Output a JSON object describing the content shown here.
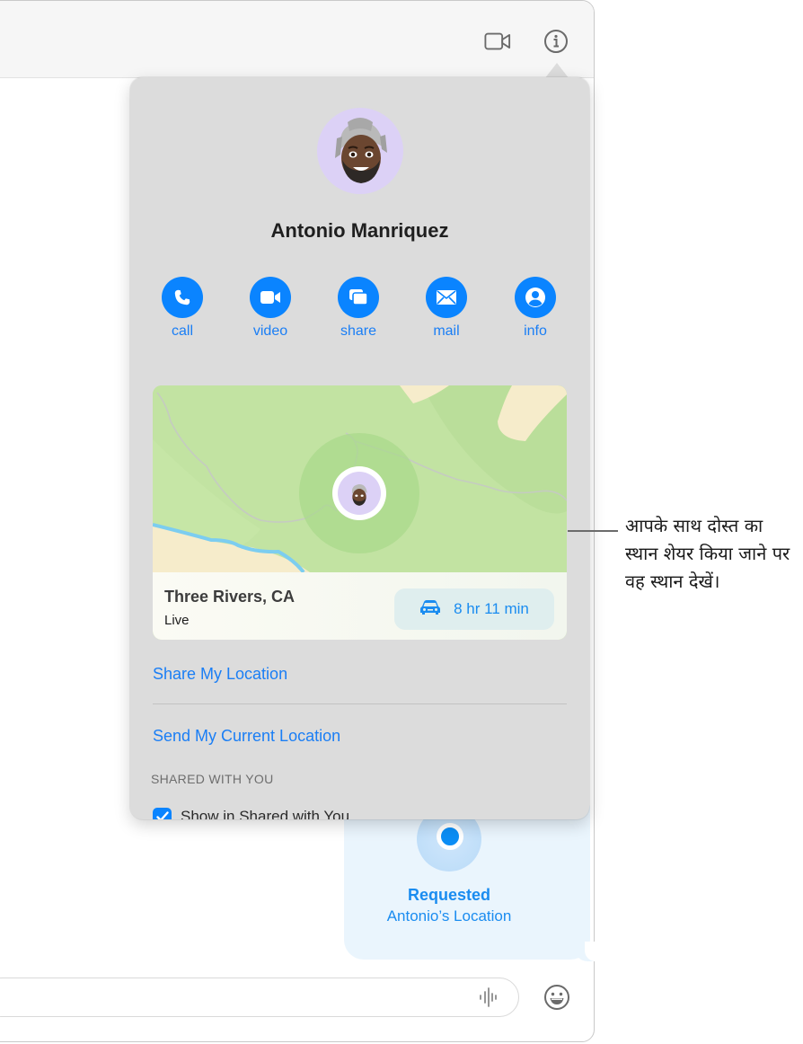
{
  "window": {
    "toolbar": {
      "video_icon": "video-camera-icon",
      "info_icon": "info-circle-icon"
    }
  },
  "popover": {
    "contact_name": "Antonio Manriquez",
    "avatar": "memoji-avatar",
    "actions": [
      {
        "label": "call",
        "icon": "phone-icon"
      },
      {
        "label": "video",
        "icon": "video-camera-icon"
      },
      {
        "label": "share",
        "icon": "share-screen-icon"
      },
      {
        "label": "mail",
        "icon": "envelope-icon"
      },
      {
        "label": "info",
        "icon": "person-circle-icon"
      }
    ],
    "map": {
      "place": "Three Rivers, CA",
      "status": "Live",
      "eta": "8 hr 11 min",
      "eta_icon": "car-icon"
    },
    "share_my_location": "Share My Location",
    "send_current_location": "Send My Current Location",
    "shared_with_you_header": "SHARED WITH YOU",
    "show_in_shared_label": "Show in Shared with You",
    "show_in_shared_checked": true
  },
  "message": {
    "title": "Requested",
    "subtitle": "Antonio’s Location"
  },
  "compose": {
    "audio_icon": "audio-waveform-icon",
    "emoji_icon": "emoji-smiley-icon"
  },
  "annotation": {
    "text": "आपके साथ दोस्त का स्थान शेयर किया जाने पर वह स्थान देखें।"
  },
  "colors": {
    "accent": "#0a84ff",
    "link": "#1a7ef5",
    "popover_bg": "#dcdcdc",
    "bubble_bg": "#eaf5fd",
    "map_green": "#bfe09e"
  }
}
